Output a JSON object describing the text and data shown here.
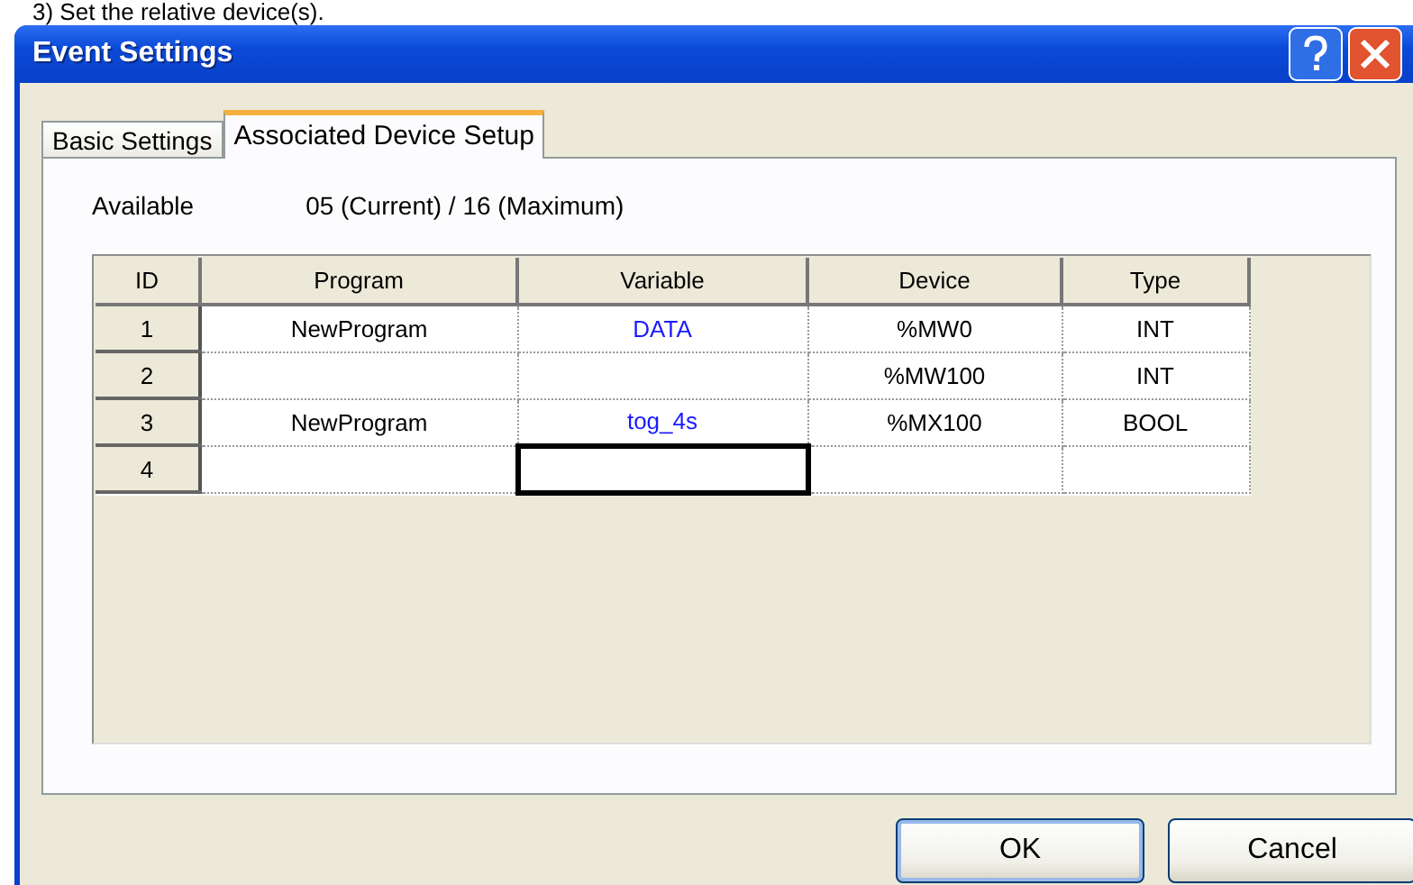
{
  "caption": "3) Set the relative device(s).",
  "window": {
    "title": "Event Settings"
  },
  "tabs": [
    {
      "label": "Basic Settings",
      "selected": false
    },
    {
      "label": "Associated Device Setup",
      "selected": true
    }
  ],
  "available": {
    "label": "Available",
    "value": "05  (Current)  /  16 (Maximum)"
  },
  "table": {
    "columns": [
      "ID",
      "Program",
      "Variable",
      "Device",
      "Type"
    ],
    "rows": [
      {
        "cells": [
          {
            "text": "1",
            "selected": false
          },
          {
            "text": "NewProgram",
            "selected": false
          },
          {
            "text": "DATA",
            "selected": false
          },
          {
            "text": "%MW0",
            "selected": false
          },
          {
            "text": "INT",
            "selected": false
          }
        ]
      },
      {
        "cells": [
          {
            "text": "2",
            "selected": false
          },
          {
            "text": "",
            "selected": false
          },
          {
            "text": "",
            "selected": false
          },
          {
            "text": "%MW100",
            "selected": false
          },
          {
            "text": "INT",
            "selected": false
          }
        ]
      },
      {
        "cells": [
          {
            "text": "3",
            "selected": false
          },
          {
            "text": "NewProgram",
            "selected": false
          },
          {
            "text": "tog_4s",
            "selected": false
          },
          {
            "text": "%MX100",
            "selected": false
          },
          {
            "text": "BOOL",
            "selected": false
          }
        ]
      },
      {
        "cells": [
          {
            "text": "4",
            "selected": false
          },
          {
            "text": "",
            "selected": false
          },
          {
            "text": "",
            "selected": true
          },
          {
            "text": "",
            "selected": false
          },
          {
            "text": "",
            "selected": false
          }
        ]
      }
    ]
  },
  "buttons": [
    {
      "label": "OK",
      "selected": true
    },
    {
      "label": "Cancel",
      "selected": false
    }
  ]
}
